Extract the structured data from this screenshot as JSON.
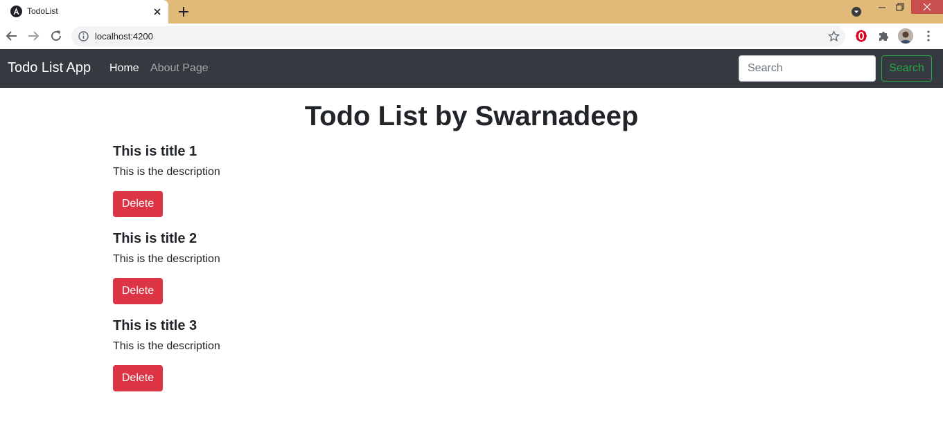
{
  "browser": {
    "tab_title": "TodoList",
    "url": "localhost:4200",
    "accent_color": "#e1b978"
  },
  "navbar": {
    "brand": "Todo List App",
    "links": [
      {
        "label": "Home",
        "active": true
      },
      {
        "label": "About Page",
        "active": false
      }
    ],
    "search_placeholder": "Search",
    "search_button": "Search",
    "background": "#343a40"
  },
  "main": {
    "heading": "Todo List by Swarnadeep",
    "todos": [
      {
        "title": "This is title 1",
        "description": "This is the description",
        "delete_label": "Delete"
      },
      {
        "title": "This is title 2",
        "description": "This is the description",
        "delete_label": "Delete"
      },
      {
        "title": "This is title 3",
        "description": "This is the description",
        "delete_label": "Delete"
      }
    ],
    "delete_color": "#dc3545",
    "search_color": "#28a745"
  }
}
